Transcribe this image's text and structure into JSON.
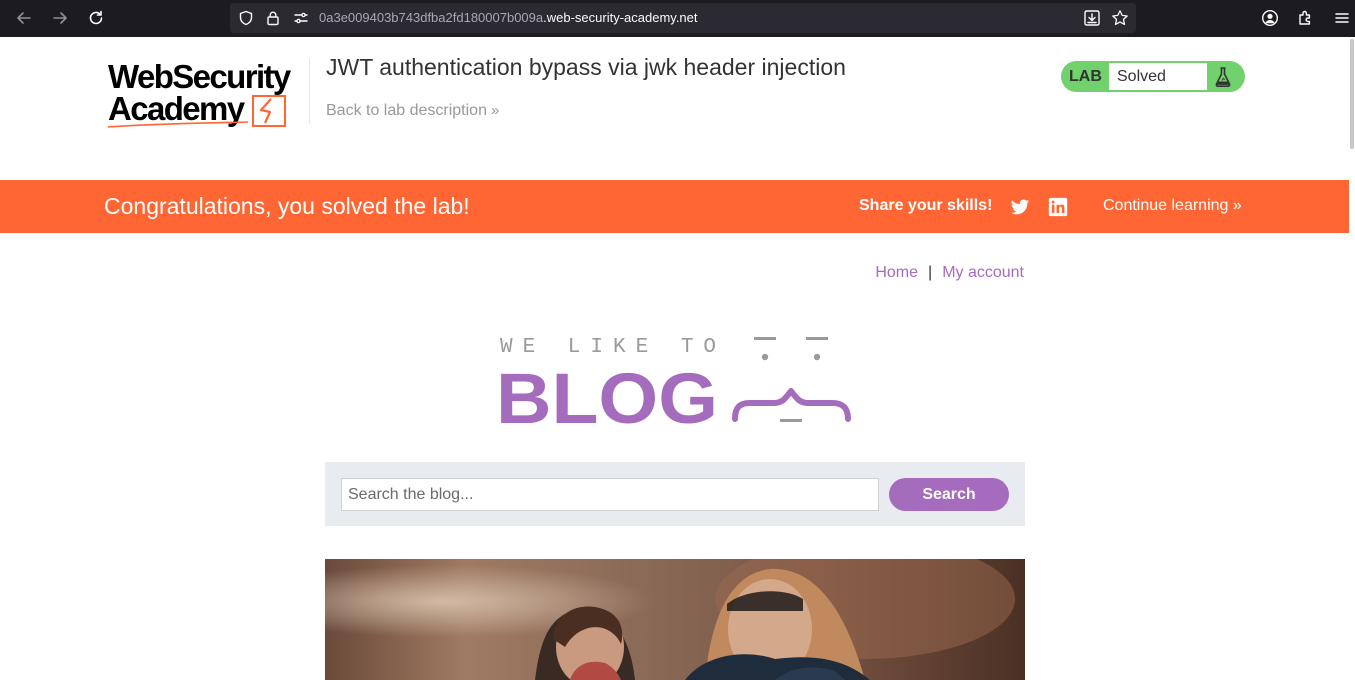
{
  "browser": {
    "url_prefix": "0a3e009403b743dfba2fd180007b009a",
    "url_domain": ".web-security-academy.net",
    "icons": [
      "back-icon",
      "forward-icon",
      "reload-icon",
      "shield-icon",
      "lock-icon",
      "permissions-icon",
      "download-icon",
      "bookmark-star-icon",
      "account-icon",
      "extensions-icon",
      "menu-icon"
    ]
  },
  "academy": {
    "logo_line1": "WebSecurity",
    "logo_line2": "Academy",
    "lab_title": "JWT authentication bypass via jwk header injection",
    "back_link": "Back to lab description",
    "lab_label": "LAB",
    "lab_status": "Solved",
    "status_color": "#70d16d"
  },
  "banner": {
    "congrats": "Congratulations, you solved the lab!",
    "share": "Share your skills!",
    "continue": "Continue learning",
    "color": "#ff6633"
  },
  "nav": {
    "home": "Home",
    "separator": "|",
    "account": "My account"
  },
  "blog": {
    "tagline": "WE LIKE TO",
    "title": "BLOG",
    "accent": "#a56bbd"
  },
  "search": {
    "placeholder": "Search the blog...",
    "value": "",
    "button": "Search"
  }
}
